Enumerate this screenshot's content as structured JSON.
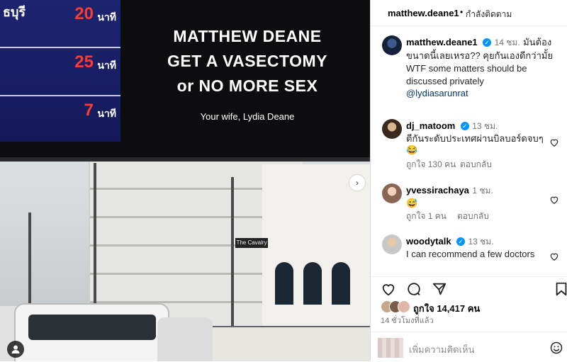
{
  "billboard": {
    "city_fragment": "ธบุรี",
    "timers": [
      {
        "value": "20",
        "unit": "นาที"
      },
      {
        "value": "25",
        "unit": "นาที"
      },
      {
        "value": "7",
        "unit": "นาที"
      }
    ],
    "lines": [
      "MATTHEW DEANE",
      "GET A VASECTOMY",
      "or NO MORE SEX"
    ],
    "signature": "Your wife, Lydia Deane",
    "sign_text": "The Cavalry"
  },
  "header": {
    "username": "matthew.deane1",
    "separator": "•",
    "follow_label": "กำลังติดตาม"
  },
  "caption": {
    "username": "matthew.deane1",
    "time": "14 ชม.",
    "text": "มันต้องขนาดนี้เลยเหรอ?? คุยกันเองดีกว่ามั้ย WTF some matters should be discussed privately",
    "mention": "@lydiasarunrat"
  },
  "comments": [
    {
      "username": "dj_matoom",
      "verified": true,
      "time": "13 ชม.",
      "text": "ตีกันระดับประเทศผ่านบิลบอร์ดจบๆ😂",
      "likes": "ถูกใจ 130 คน",
      "reply": "ตอบกลับ"
    },
    {
      "username": "yvessirachaya",
      "verified": false,
      "time": "1 ชม.",
      "text": "😅",
      "likes": "ถูกใจ 1 คน",
      "reply": "ตอบกลับ"
    },
    {
      "username": "woodytalk",
      "verified": true,
      "time": "13 ชม.",
      "text": "I can recommend a few doctors",
      "likes": "",
      "reply": ""
    }
  ],
  "post": {
    "likes_text": "ถูกใจ 14,417 คน",
    "time_ago": "14 ชั่วโมงที่แล้ว",
    "add_comment_placeholder": "เพิ่มความคิดเห็น"
  },
  "icons": {
    "verified": "✓",
    "next": "›",
    "emoji": "smile-icon"
  },
  "colors": {
    "verified_blue": "#0095f6",
    "mention": "#00376b",
    "timer_red": "#ff3b2f",
    "billboard_black": "#0d0d0f",
    "timer_blue": "#1d2470"
  }
}
